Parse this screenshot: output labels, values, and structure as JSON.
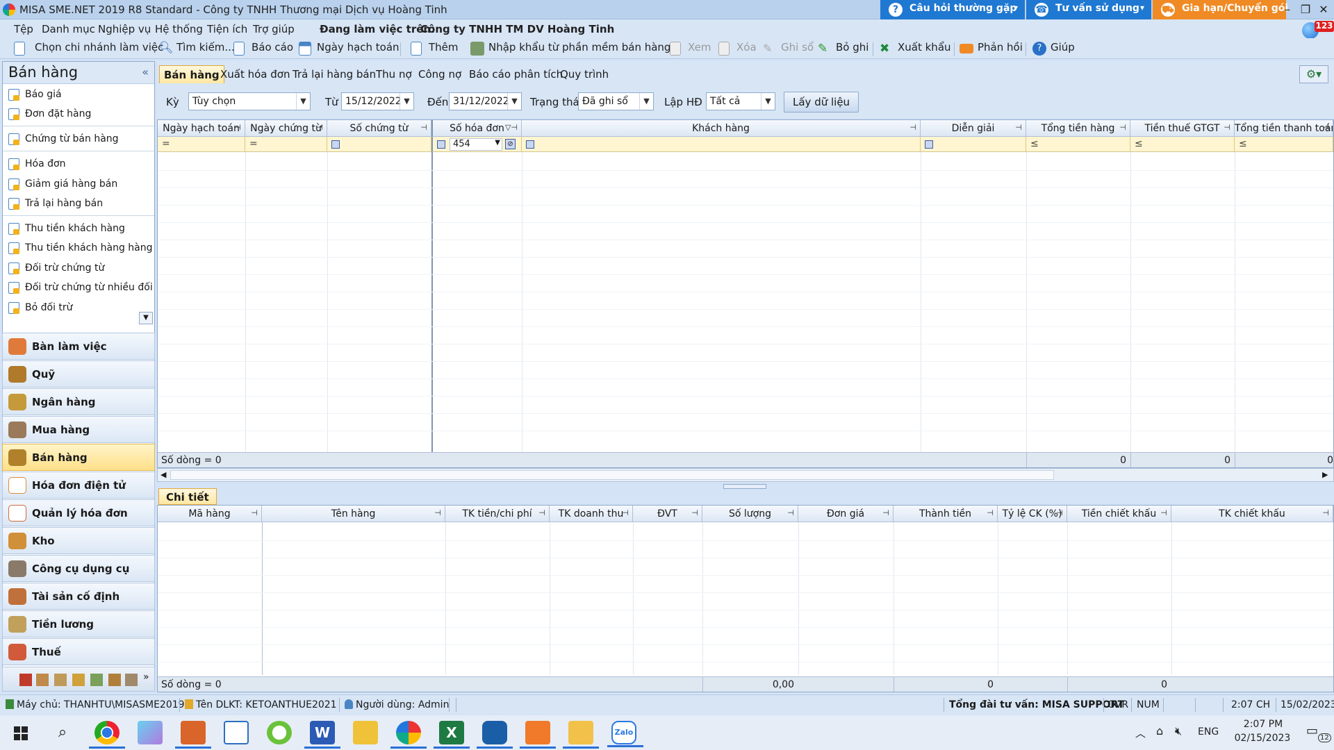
{
  "window": {
    "title": "MISA SME.NET 2019 R8 Standard - Công ty TNHH Thương mại Dịch vụ Hoàng Tinh",
    "faq_label": "Câu hỏi thường gặp",
    "consult_label": "Tư vấn sử dụng",
    "renew_label": "Gia hạn/Chuyển gói",
    "badge": "123",
    "accent_blue": "#1f78d1",
    "accent_orange": "#f08a24"
  },
  "menu": {
    "items": [
      "Tệp",
      "Danh mục",
      "Nghiệp vụ",
      "Hệ thống",
      "Tiện ích",
      "Trợ giúp"
    ],
    "working_on_label": "Đang làm việc trên:",
    "working_on_company": "Công ty TNHH TM DV Hoàng Tinh"
  },
  "toolbar": {
    "branch": "Chọn chi nhánh làm việc",
    "search": "Tìm kiếm...",
    "report": "Báo cáo",
    "posting_date": "Ngày hạch toán",
    "add": "Thêm",
    "import": "Nhập khẩu từ phần mềm bán hàng",
    "view": "Xem",
    "delete": "Xóa",
    "post": "Ghi sổ",
    "unpost": "Bỏ ghi",
    "export": "Xuất khẩu",
    "feedback": "Phản hồi",
    "help": "Giúp"
  },
  "sidebar": {
    "header": "Bán hàng",
    "items": [
      "Báo giá",
      "Đơn đặt hàng",
      "Chứng từ bán hàng",
      "Hóa đơn",
      "Giảm giá hàng bán",
      "Trả lại hàng bán",
      "Thu tiền khách hàng",
      "Thu tiền khách hàng hàng l...",
      "Đối trừ chứng từ",
      "Đối trừ chứng từ nhiều đối t...",
      "Bỏ đối trừ"
    ],
    "modules": [
      "Bàn làm việc",
      "Quỹ",
      "Ngân hàng",
      "Mua hàng",
      "Bán hàng",
      "Hóa đơn điện tử",
      "Quản lý hóa đơn",
      "Kho",
      "Công cụ dụng cụ",
      "Tài sản cố định",
      "Tiền lương",
      "Thuế"
    ],
    "selected_module": "Bán hàng"
  },
  "tabs": [
    "Bán hàng",
    "Xuất hóa đơn",
    "Trả lại hàng bán",
    "Thu nợ",
    "Công nợ",
    "Báo cáo phân tích",
    "Quy trình"
  ],
  "filter": {
    "period_label": "Kỳ",
    "period_value": "Tùy chọn",
    "from_label": "Từ",
    "from_value": "15/12/2022",
    "to_label": "Đến",
    "to_value": "31/12/2022",
    "status_label": "Trạng thái",
    "status_value": "Đã ghi sổ",
    "invoice_label": "Lập HĐ",
    "invoice_value": "Tất cả",
    "load_button": "Lấy dữ liệu"
  },
  "main_grid": {
    "columns": [
      "Ngày hạch toán",
      "Ngày chứng từ",
      "Số chứng từ",
      "Số hóa đơn",
      "Khách hàng",
      "Diễn giải",
      "Tổng tiền hàng",
      "Tiền thuế GTGT",
      "Tổng tiền thanh toán"
    ],
    "filter_ops": [
      "=",
      "=",
      "",
      "",
      "",
      "",
      "≤",
      "≤",
      "≤"
    ],
    "invoice_filter_value": "454",
    "row_count": "Số dòng = 0",
    "totals": [
      "0",
      "0",
      "0"
    ]
  },
  "detail": {
    "tab": "Chi tiết",
    "columns": [
      "Mã hàng",
      "Tên hàng",
      "TK tiền/chi phí",
      "TK doanh thu",
      "ĐVT",
      "Số lượng",
      "Đơn giá",
      "Thành tiền",
      "Tỷ lệ CK (%)",
      "Tiền chiết khấu",
      "TK chiết khấu"
    ],
    "row_count": "Số dòng = 0",
    "qty_total": "0,00",
    "amount_total": "0",
    "discount_total": "0"
  },
  "statusbar": {
    "server": "Máy chủ: THANHTU\\MISASME2019",
    "db": "Tên DLKT: KETOANTHUE2021",
    "user": "Người dùng: Admin",
    "hotline": "Tổng đài tư vấn: MISA SUPPORT",
    "ovr": "OVR",
    "num": "NUM",
    "time": "2:07 CH",
    "date": "15/02/2023"
  },
  "taskbar": {
    "lang": "ENG",
    "time": "2:07 PM",
    "date": "02/15/2023",
    "notifications": "12"
  }
}
